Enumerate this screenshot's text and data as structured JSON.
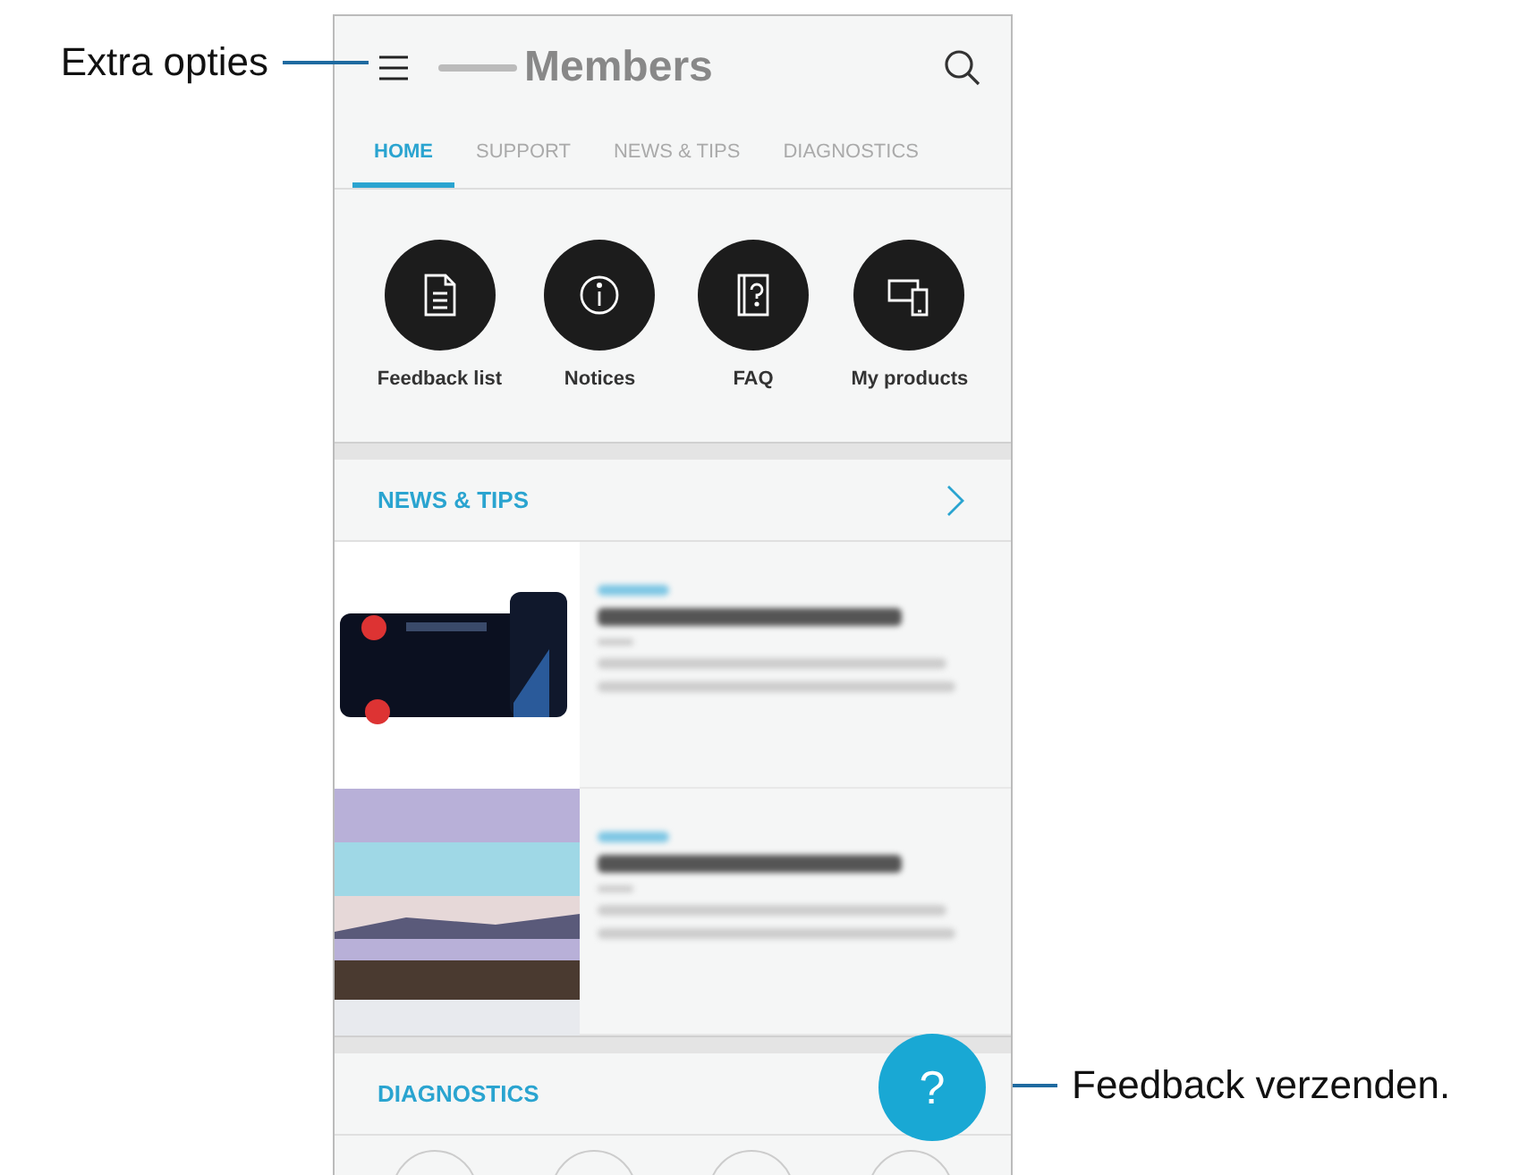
{
  "callouts": [
    {
      "kind": "left",
      "text": "Extra opties"
    },
    {
      "kind": "right",
      "text": "Feedback verzenden."
    }
  ],
  "app": {
    "title": "Members"
  },
  "tabs": [
    {
      "label": "HOME",
      "selected": true
    },
    {
      "label": "SUPPORT",
      "selected": false
    },
    {
      "label": "NEWS & TIPS",
      "selected": false
    },
    {
      "label": "DIAGNOSTICS",
      "selected": false
    }
  ],
  "shortcuts": [
    {
      "kind": "document",
      "label": "Feedback list"
    },
    {
      "kind": "info",
      "label": "Notices"
    },
    {
      "kind": "faq",
      "label": "FAQ"
    },
    {
      "kind": "devices",
      "label": "My products"
    }
  ],
  "news": {
    "title": "NEWS & TIPS"
  },
  "diagnostics": {
    "title": "DIAGNOSTICS"
  },
  "fab": {
    "label": "?"
  }
}
